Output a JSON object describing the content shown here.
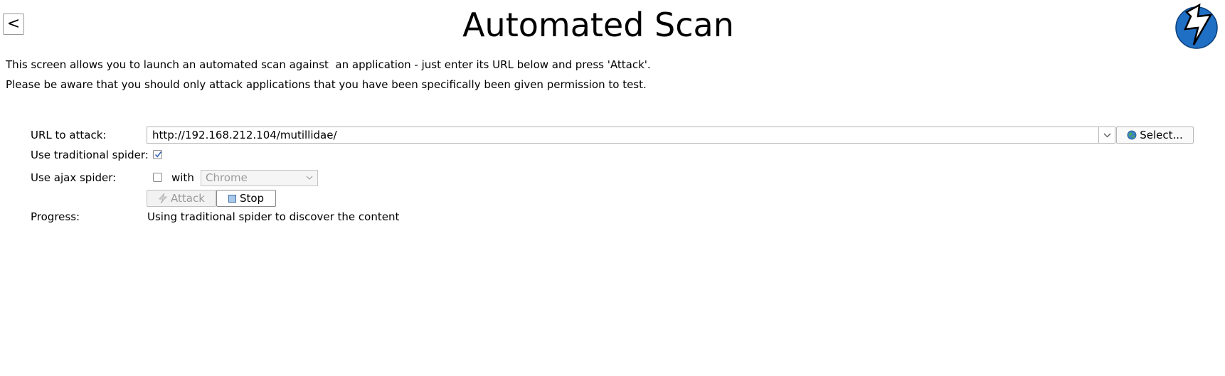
{
  "header": {
    "back_label": "<",
    "title": "Automated Scan"
  },
  "description": {
    "line1": "This screen allows you to launch an automated scan against  an application - just enter its URL below and press 'Attack'.",
    "line2": "Please be aware that you should only attack applications that you have been specifically been given permission to test."
  },
  "form": {
    "url_label": "URL to attack:",
    "url_value": "http://192.168.212.104/mutillidae/",
    "select_label": "Select...",
    "traditional_spider_label": "Use traditional spider:",
    "traditional_spider_checked": true,
    "ajax_spider_label": "Use ajax spider:",
    "ajax_spider_checked": false,
    "with_label": "with",
    "browser_selected": "Chrome",
    "attack_label": "Attack",
    "stop_label": "Stop",
    "progress_label": "Progress:",
    "progress_text": "Using traditional spider to discover the content"
  },
  "icons": {
    "logo": "zap-lightning-logo",
    "globe": "globe-icon",
    "attack": "lightning-icon",
    "stop": "stop-icon"
  },
  "colors": {
    "logo_blue": "#1f6fc4",
    "stop_fill": "#a9c8ea",
    "checkmark": "#2a5ea8",
    "disabled_text": "#9a9a9a"
  }
}
